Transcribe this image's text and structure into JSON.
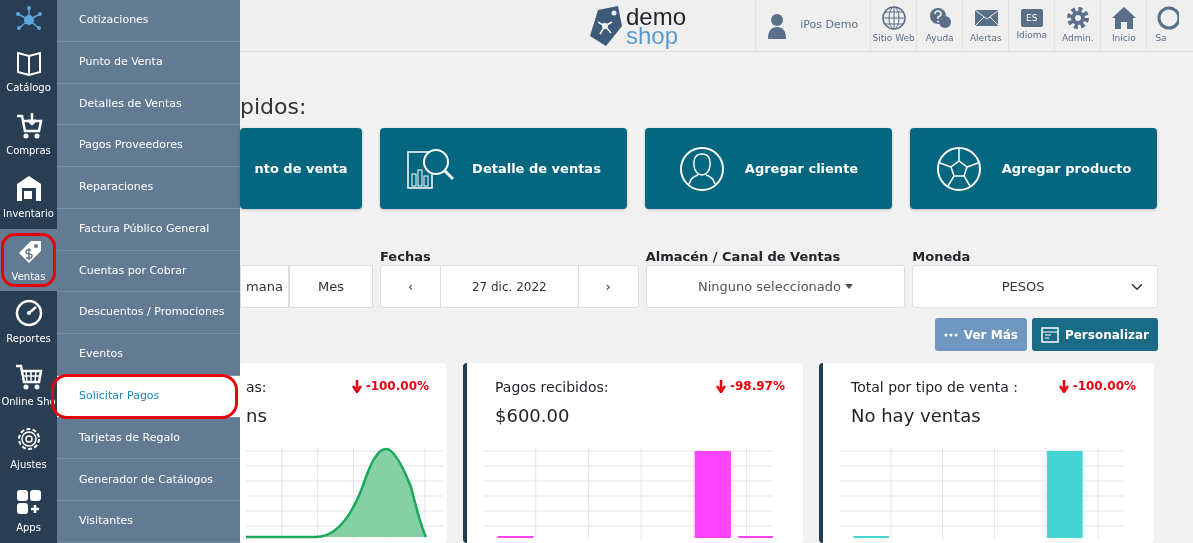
{
  "sidebar": {
    "items": [
      {
        "label": "Catálogo",
        "selected": false,
        "annotated": false
      },
      {
        "label": "Compras",
        "selected": false,
        "annotated": false
      },
      {
        "label": "Inventario",
        "selected": false,
        "annotated": false
      },
      {
        "label": "Ventas",
        "selected": true,
        "annotated": true
      },
      {
        "label": "Reportes",
        "selected": false,
        "annotated": false
      },
      {
        "label": "Online Sho",
        "selected": false,
        "annotated": false
      },
      {
        "label": "Ajustes",
        "selected": false,
        "annotated": false
      },
      {
        "label": "Apps",
        "selected": false,
        "annotated": false
      }
    ]
  },
  "submenu": {
    "items": [
      {
        "label": "Cotizaciones",
        "selected": false,
        "annotated": false
      },
      {
        "label": "Punto de Venta",
        "selected": false,
        "annotated": false
      },
      {
        "label": "Detalles de Ventas",
        "selected": false,
        "annotated": false
      },
      {
        "label": "Pagos Proveedores",
        "selected": false,
        "annotated": false
      },
      {
        "label": "Reparaciones",
        "selected": false,
        "annotated": false
      },
      {
        "label": "Factura Público General",
        "selected": false,
        "annotated": false
      },
      {
        "label": "Cuentas por Cobrar",
        "selected": false,
        "annotated": false
      },
      {
        "label": "Descuentos / Promociones",
        "selected": false,
        "annotated": false
      },
      {
        "label": "Eventos",
        "selected": false,
        "annotated": false
      },
      {
        "label": "Solicitar Pagos",
        "selected": true,
        "annotated": true
      },
      {
        "label": "Tarjetas de Regalo",
        "selected": false,
        "annotated": false
      },
      {
        "label": "Generador de Catálogos",
        "selected": false,
        "annotated": false
      },
      {
        "label": "Visitantes",
        "selected": false,
        "annotated": false
      }
    ]
  },
  "header": {
    "logo": {
      "top": "demo",
      "bottom": "shop"
    },
    "user": "iPos Demo",
    "language_badge": "ES",
    "tools": [
      "Sitio Web",
      "Ayuda",
      "Alertas",
      "Idioma",
      "Admin.",
      "Inicio",
      "Sa"
    ]
  },
  "section_title": "pidos:",
  "quick_actions": [
    "nto de venta",
    "Detalle de ventas",
    "Agregar cliente",
    "Agregar producto"
  ],
  "filters": {
    "periods": [
      {
        "label": "mana",
        "selected": false
      },
      {
        "label": "Mes",
        "selected": false
      }
    ],
    "dates_label": "Fechas",
    "prev": "‹",
    "date": "27 dic. 2022",
    "next": "›",
    "channel_label": "Almacén / Canal de Ventas",
    "channel_value": "Ninguno seleccionado",
    "currency_label": "Moneda",
    "currency_value": "PESOS"
  },
  "buttons": [
    "Ver Más",
    "Personalizar"
  ],
  "stats": [
    {
      "title": "as:",
      "value": "ns",
      "change": "-100.00%",
      "kind": "area",
      "color": "#1aa85a"
    },
    {
      "title": "Pagos recibidos:",
      "value": "$600.00",
      "change": "-98.97%",
      "kind": "bar",
      "color": "#ff44ff"
    },
    {
      "title": "Total por tipo de venta :",
      "value": "No hay ventas",
      "change": "-100.00%",
      "kind": "bar",
      "color": "#44d4d4"
    }
  ]
}
